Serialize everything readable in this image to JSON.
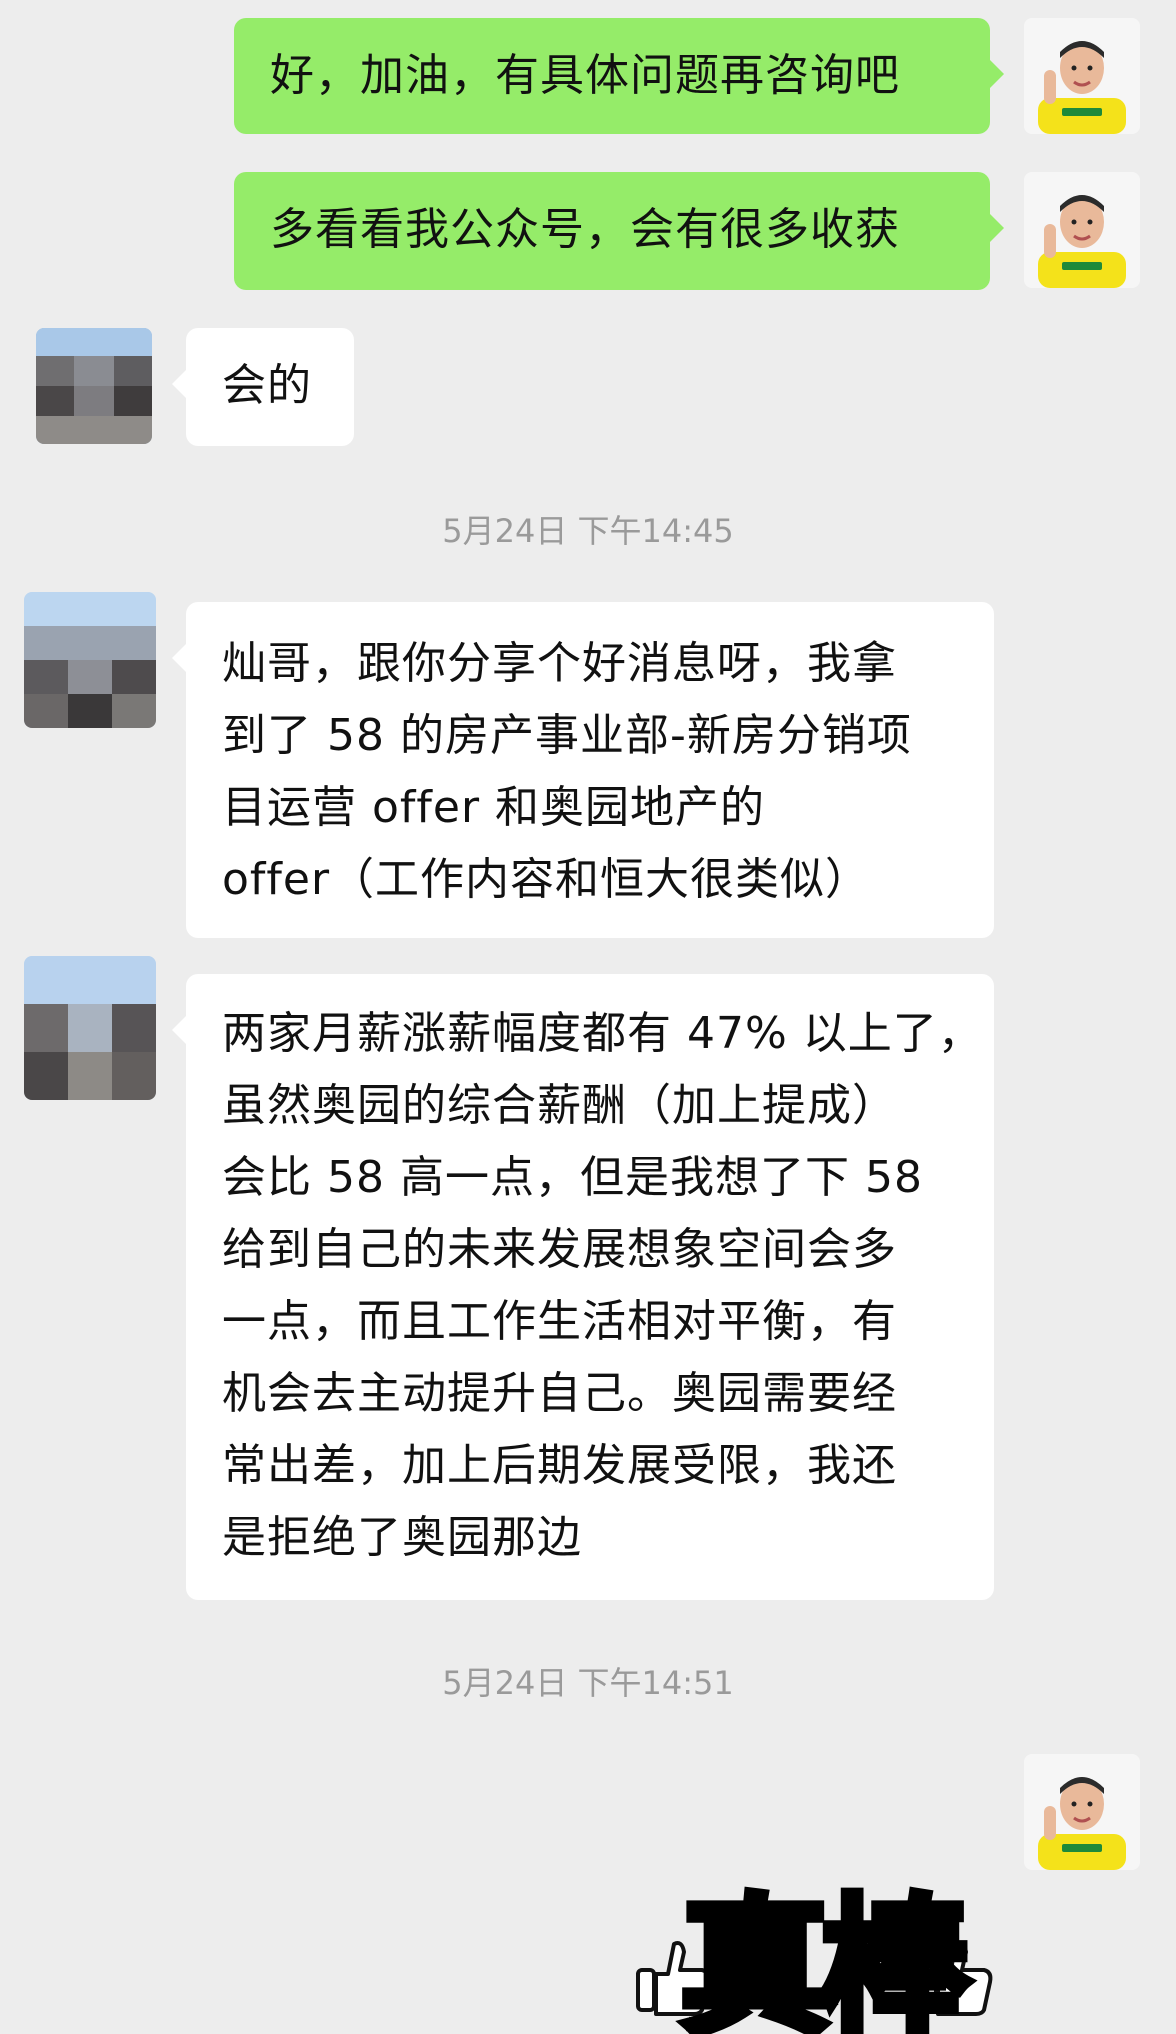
{
  "messages": [
    {
      "sender": "me",
      "text": "好，加油，有具体问题再咨询吧"
    },
    {
      "sender": "me",
      "text": "多看看我公众号，会有很多收获"
    },
    {
      "sender": "other",
      "text": "会的"
    },
    {
      "type": "timestamp",
      "text": "5月24日 下午14:45"
    },
    {
      "sender": "other",
      "text": "灿哥，跟你分享个好消息呀，我拿\n到了 58 的房产事业部-新房分销项\n目运营 offer 和奥园地产的\noffer（工作内容和恒大很类似）"
    },
    {
      "sender": "other",
      "text": "两家月薪涨薪幅度都有 47% 以上了，\n虽然奥园的综合薪酬（加上提成）\n会比 58 高一点，但是我想了下 58\n给到自己的未来发展想象空间会多\n一点，而且工作生活相对平衡，有\n机会去主动提升自己。奥园需要经\n常出差，加上后期发展受限，我还\n是拒绝了奥园那边"
    },
    {
      "type": "timestamp",
      "text": "5月24日 下午14:51"
    },
    {
      "sender": "me",
      "type": "sticker",
      "sticker_text": "真棒",
      "sticker_icon": "thumbs-up-icon"
    }
  ],
  "colors": {
    "background": "#ededed",
    "my_bubble": "#95ec69",
    "other_bubble": "#ffffff",
    "timestamp_text": "#9a9a9a",
    "my_avatar_shirt": "#f4e21a"
  },
  "avatars": {
    "me": "avatar-photo-man-yellow-shirt",
    "other": "avatar-photo-blurred"
  }
}
